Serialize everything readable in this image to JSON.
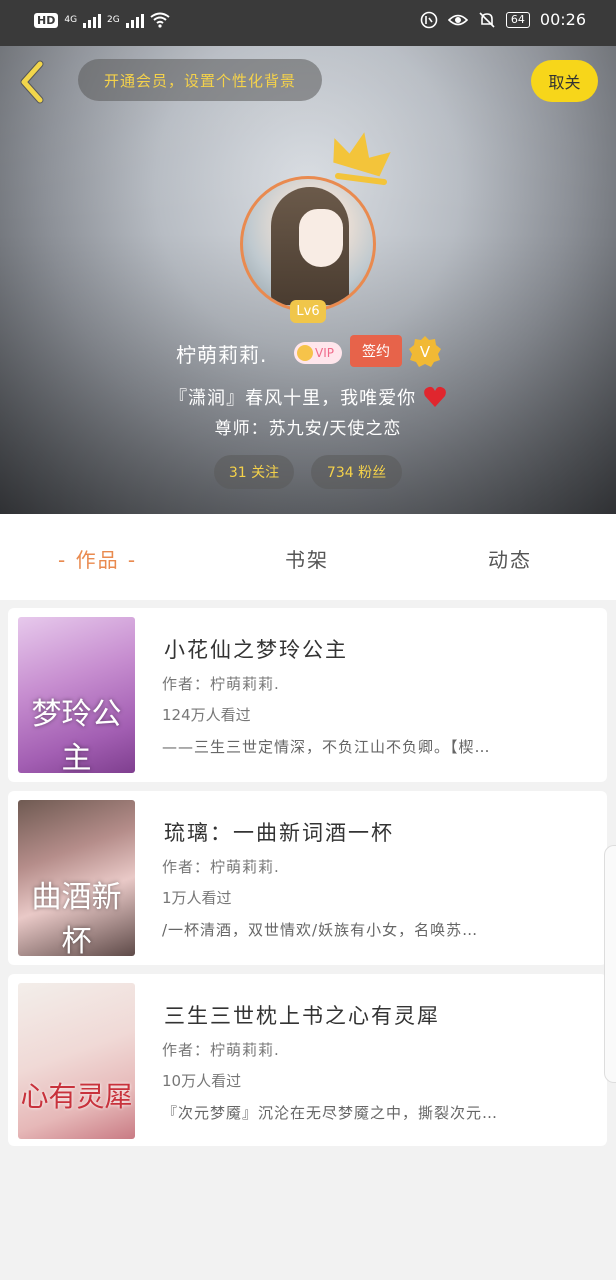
{
  "status_bar": {
    "network_hd": "HD",
    "net1": "4G",
    "net2": "2G",
    "battery": "64",
    "time": "00:26"
  },
  "header": {
    "vip_prompt": "开通会员，设置个性化背景",
    "follow_label": "取关",
    "level": "Lv6",
    "name": "柠萌莉莉.",
    "vip_badge": "VIP",
    "sign_badge": "签约",
    "v_badge": "V",
    "signature": "『潇涧』春风十里，我唯爱你",
    "mentor": "尊师：苏九安/天使之恋",
    "following": "31 关注",
    "followers": "734 粉丝"
  },
  "tabs": [
    {
      "label": "- 作品 -",
      "active": true
    },
    {
      "label": "书架",
      "active": false
    },
    {
      "label": "动态",
      "active": false
    }
  ],
  "books": [
    {
      "title": "小花仙之梦玲公主",
      "author": "作者：柠萌莉莉.",
      "views": "124万人看过",
      "desc": "——三生三世定情深，不负江山不负卿。【楔…",
      "cover_text": "梦玲公主"
    },
    {
      "title": "琉璃：一曲新词酒一杯",
      "author": "作者：柠萌莉莉.",
      "views": "1万人看过",
      "desc": "/一杯清酒，双世情欢/妖族有小女，名唤苏…",
      "cover_text": "曲酒新杯"
    },
    {
      "title": "三生三世枕上书之心有灵犀",
      "author": "作者：柠萌莉莉.",
      "views": "10万人看过",
      "desc": "『次元梦魇』沉沦在无尽梦魇之中，撕裂次元…",
      "cover_text": "心有灵犀"
    }
  ],
  "colors": {
    "accent": "#e98a4f",
    "gold": "#f5d24a",
    "follow_bg": "#f7d61a",
    "heart": "#e0262e"
  },
  "icons": {
    "back": "chevron-left-icon",
    "crown": "crown-icon",
    "heart": "heart-icon"
  }
}
